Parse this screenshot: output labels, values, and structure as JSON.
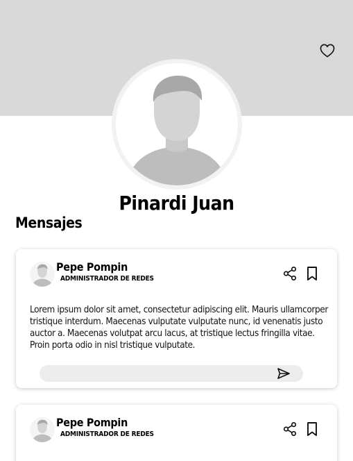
{
  "profile": {
    "name": "Pinardi Juan"
  },
  "messages_section": {
    "title": "Mensajes"
  },
  "messages": [
    {
      "author": "Pepe Pompin",
      "role": "ADMINISTRADOR DE REDES",
      "body": "Lorem ipsum dolor sit amet, consectetur adipiscing elit. Mauris ullamcorper tristique interdum. Maecenas vulputate vulputate nunc, id venenatis justo auctor a. Maecenas volutpat arcu lacus, at tristique lectus fringilla vitae. Proin porta odio in nisl tristique vulputate.",
      "reply_value": ""
    },
    {
      "author": "Pepe Pompin",
      "role": "ADMINISTRADOR DE REDES"
    }
  ],
  "icons": {
    "favorite": "heart-icon",
    "share": "share-icon",
    "bookmark": "bookmark-icon",
    "send": "send-icon"
  },
  "colors": {
    "cover": "#d9d9d9",
    "avatar_placeholder": "#bdbdbd",
    "reply_box": "#ececec"
  }
}
